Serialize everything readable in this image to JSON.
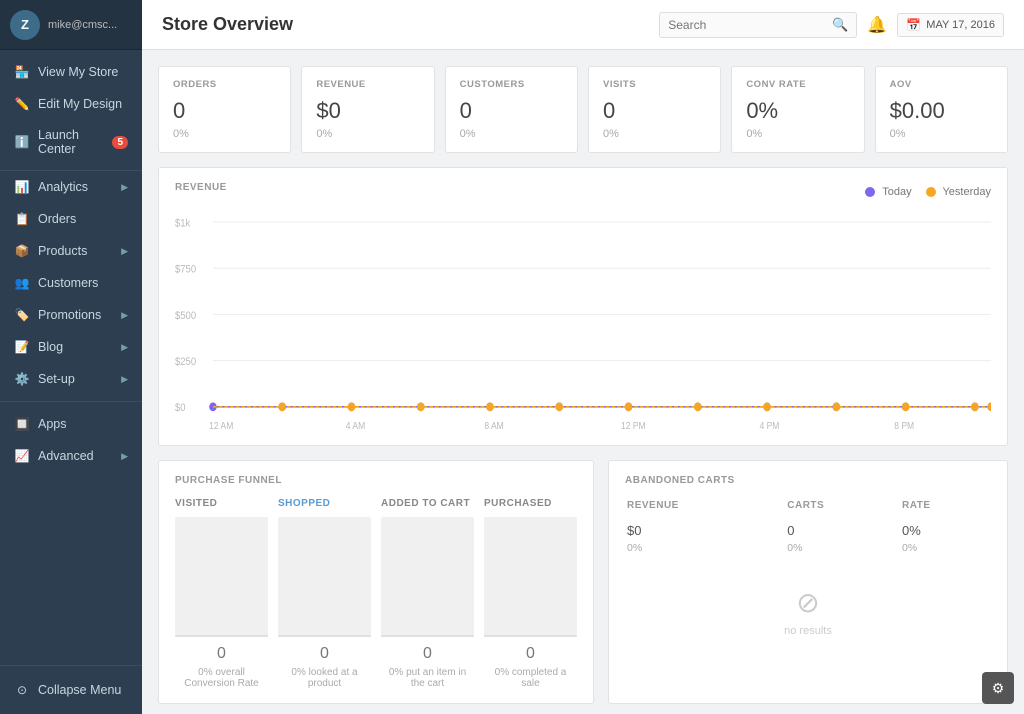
{
  "sidebar": {
    "username": "mike@cmsc...",
    "avatar_initial": "Z",
    "nav_top": [
      {
        "id": "view-my-store",
        "label": "View My Store",
        "icon": "🏪",
        "has_arrow": false
      },
      {
        "id": "edit-my-design",
        "label": "Edit My Design",
        "icon": "✏️",
        "has_arrow": false
      },
      {
        "id": "launch-center",
        "label": "Launch Center",
        "icon": "ℹ️",
        "badge": "5",
        "has_arrow": false
      }
    ],
    "nav_main": [
      {
        "id": "analytics",
        "label": "Analytics",
        "icon": "📊",
        "has_arrow": true
      },
      {
        "id": "orders",
        "label": "Orders",
        "icon": "📋",
        "has_arrow": false
      },
      {
        "id": "products",
        "label": "Products",
        "icon": "📦",
        "has_arrow": true
      },
      {
        "id": "customers",
        "label": "Customers",
        "icon": "👥",
        "has_arrow": false
      },
      {
        "id": "promotions",
        "label": "Promotions",
        "icon": "🏷️",
        "has_arrow": true
      },
      {
        "id": "blog",
        "label": "Blog",
        "icon": "📝",
        "has_arrow": true
      },
      {
        "id": "set-up",
        "label": "Set-up",
        "icon": "⚙️",
        "has_arrow": true
      }
    ],
    "nav_bottom": [
      {
        "id": "apps",
        "label": "Apps",
        "icon": "🔲",
        "has_arrow": false
      },
      {
        "id": "advanced",
        "label": "Advanced",
        "icon": "📈",
        "has_arrow": true
      }
    ],
    "collapse_label": "Collapse Menu"
  },
  "topbar": {
    "title": "Store Overview",
    "search_placeholder": "Search",
    "date": "MAY 17, 2016"
  },
  "stats": [
    {
      "id": "orders",
      "label": "ORDERS",
      "value": "0",
      "change": "0%"
    },
    {
      "id": "revenue",
      "label": "REVENUE",
      "value": "$0",
      "change": "0%"
    },
    {
      "id": "customers",
      "label": "CUSTOMERS",
      "value": "0",
      "change": "0%"
    },
    {
      "id": "visits",
      "label": "VISITS",
      "value": "0",
      "change": "0%"
    },
    {
      "id": "conv-rate",
      "label": "CONV RATE",
      "value": "0%",
      "change": "0%"
    },
    {
      "id": "aov",
      "label": "AOV",
      "value": "$0.00",
      "change": "0%"
    }
  ],
  "revenue_chart": {
    "title": "REVENUE",
    "legend_today": "Today",
    "legend_yesterday": "Yesterday",
    "y_labels": [
      "$1k",
      "$750",
      "$500",
      "$250",
      "$0"
    ],
    "x_labels": [
      "12 AM",
      "4 AM",
      "8 AM",
      "12 PM",
      "4 PM",
      "8 PM"
    ],
    "today_color": "#7b68ee",
    "yesterday_color": "#f5a623"
  },
  "purchase_funnel": {
    "title": "PURCHASE FUNNEL",
    "columns": [
      {
        "id": "visited",
        "label": "VISITED",
        "is_blue": false,
        "value": "0",
        "desc": "0% overall\nConversion Rate"
      },
      {
        "id": "shopped",
        "label": "SHOPPED",
        "is_blue": true,
        "value": "0",
        "desc": "0% looked at a\nproduct"
      },
      {
        "id": "added-to-cart",
        "label": "ADDED TO CART",
        "is_blue": false,
        "value": "0",
        "desc": "0% put an item in\nthe cart"
      },
      {
        "id": "purchased",
        "label": "PURCHASED",
        "is_blue": false,
        "value": "0",
        "desc": "0% completed a\nsale"
      }
    ]
  },
  "abandoned_carts": {
    "title": "ABANDONED CARTS",
    "columns": [
      "REVENUE",
      "CARTS",
      "RATE"
    ],
    "revenue_value": "$0",
    "revenue_change": "0%",
    "carts_value": "0",
    "carts_change": "0%",
    "rate_value": "0%",
    "rate_change": "0%",
    "no_results_text": "no results"
  }
}
